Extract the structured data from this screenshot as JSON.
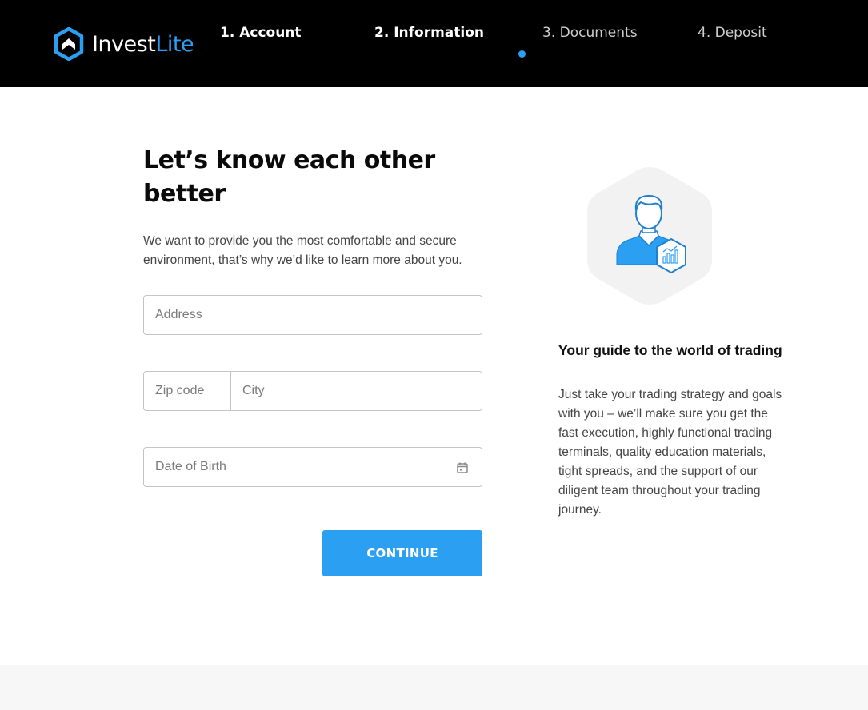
{
  "brand": {
    "name_part1": "Invest",
    "name_part2": "Lite",
    "color": "#2b9ff2"
  },
  "steps": [
    {
      "label": "1. Account",
      "state": "completed"
    },
    {
      "label": "2. Information",
      "state": "current"
    },
    {
      "label": "3. Documents",
      "state": "upcoming"
    },
    {
      "label": "4. Deposit",
      "state": "upcoming"
    }
  ],
  "form": {
    "title": "Let’s know each other better",
    "intro": "We want to provide you the most comfortable and secure environment, that’s why we’d like to learn more about you.",
    "address_placeholder": "Address",
    "zip_placeholder": "Zip code",
    "city_placeholder": "City",
    "dob_placeholder": "Date of Birth",
    "continue_label": "CONTINUE"
  },
  "guide": {
    "icon": "user-chart-icon",
    "title": "Your guide to the world of trading",
    "text": "Just take your trading strategy and goals with you – we’ll make sure you get the fast execution, highly functional trading terminals, quality education materials, tight spreads, and the support of our diligent team throughout your trading journey."
  }
}
